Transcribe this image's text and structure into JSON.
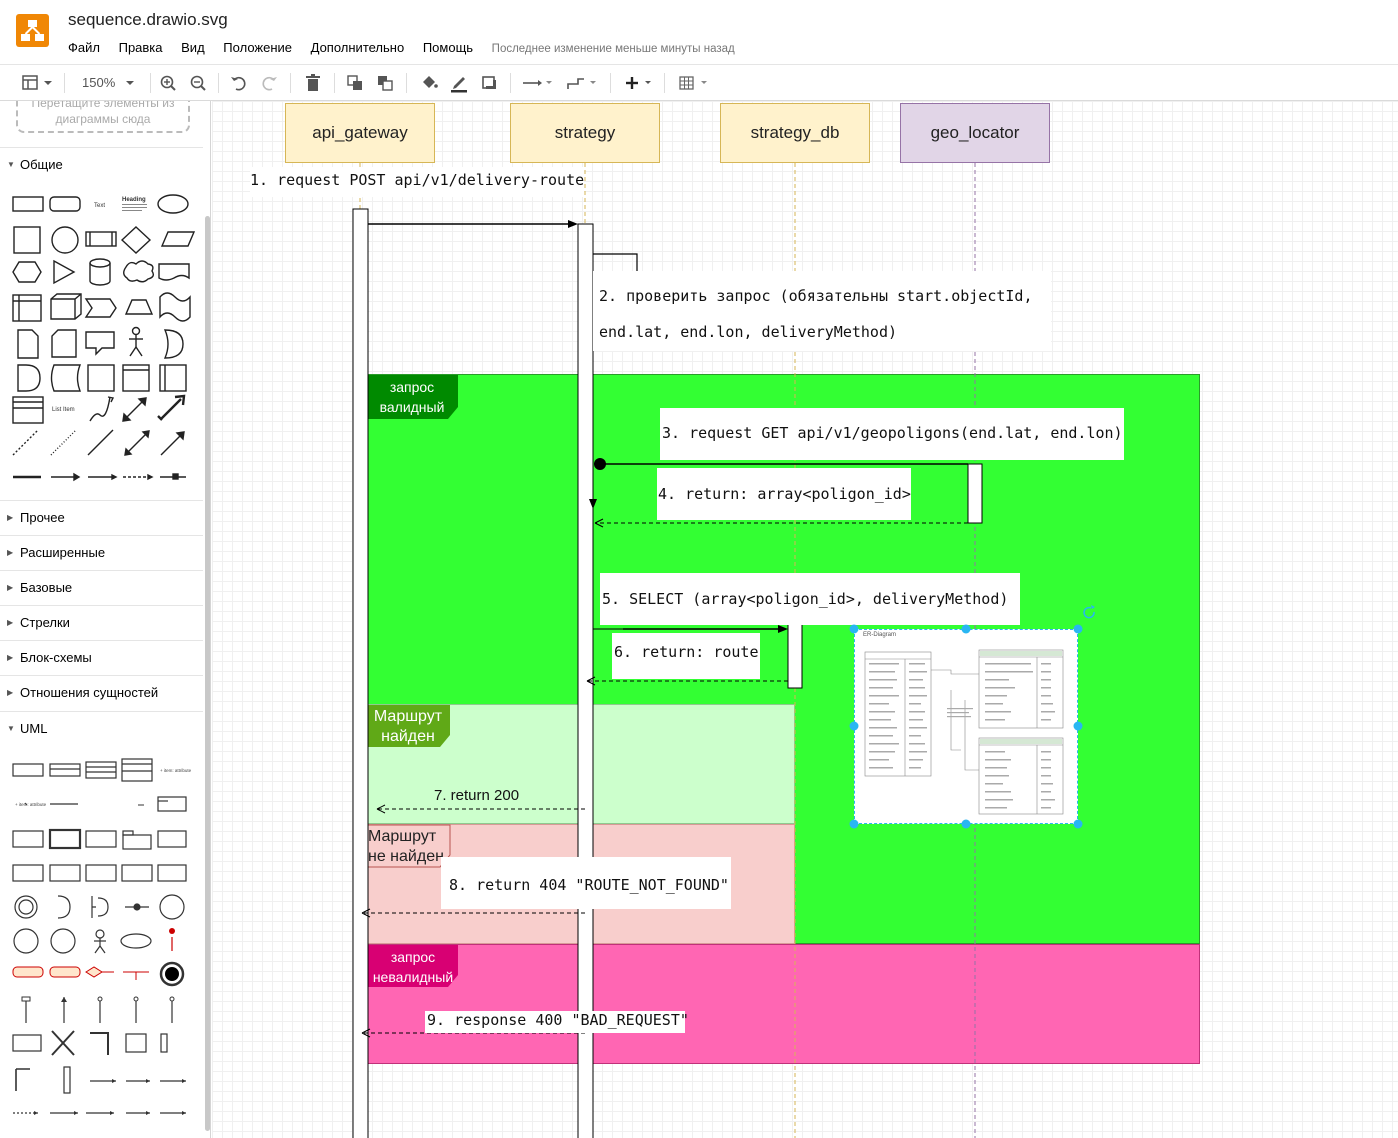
{
  "app": {
    "title": "sequence.drawio.svg",
    "status": "Последнее изменение меньше минуты назад"
  },
  "menu": [
    "Файл",
    "Правка",
    "Вид",
    "Положение",
    "Дополнительно",
    "Помощь"
  ],
  "toolbar": {
    "zoom": "150%"
  },
  "sidebar": {
    "dropzone": "Перетащите элементы из диаграммы сюда",
    "sections": [
      {
        "label": "Общие",
        "open": true
      },
      {
        "label": "Прочее",
        "open": false
      },
      {
        "label": "Расширенные",
        "open": false
      },
      {
        "label": "Базовые",
        "open": false
      },
      {
        "label": "Стрелки",
        "open": false
      },
      {
        "label": "Блок-схемы",
        "open": false
      },
      {
        "label": "Отношения сущностей",
        "open": false
      },
      {
        "label": "UML",
        "open": true
      }
    ]
  },
  "diagram": {
    "participants": [
      "api_gateway",
      "strategy",
      "strategy_db",
      "geo_locator"
    ],
    "messages": [
      "1. request POST api/v1/delivery-route",
      "2. проверить запрос (обязательны  start.objectId,",
      "end.lat, end.lon, deliveryMethod)",
      "3. request GET api/v1/geopoligons(end.lat, end.lon)",
      "4. return: array<poligon_id>",
      "5. SELECT (array<poligon_id>,  deliveryMethod)",
      "6. return: route",
      "7. return 200",
      "8. return 404 \"ROUTE_NOT_FOUND\"",
      "9. response 400 \"BAD_REQUEST\""
    ],
    "frames": {
      "valid": "запрос валидный",
      "found": "Маршрут найден",
      "notfound": "Маршрут не найден",
      "invalid": "запрос невалидный"
    },
    "er_title": "ER-Diagram",
    "colors": {
      "valid": "#33ff33",
      "found": "#ccffcc",
      "notfound": "#f8cecc",
      "invalid": "#ff66b3",
      "participant": "#fff2cc",
      "geo": "#e1d5e7"
    }
  }
}
